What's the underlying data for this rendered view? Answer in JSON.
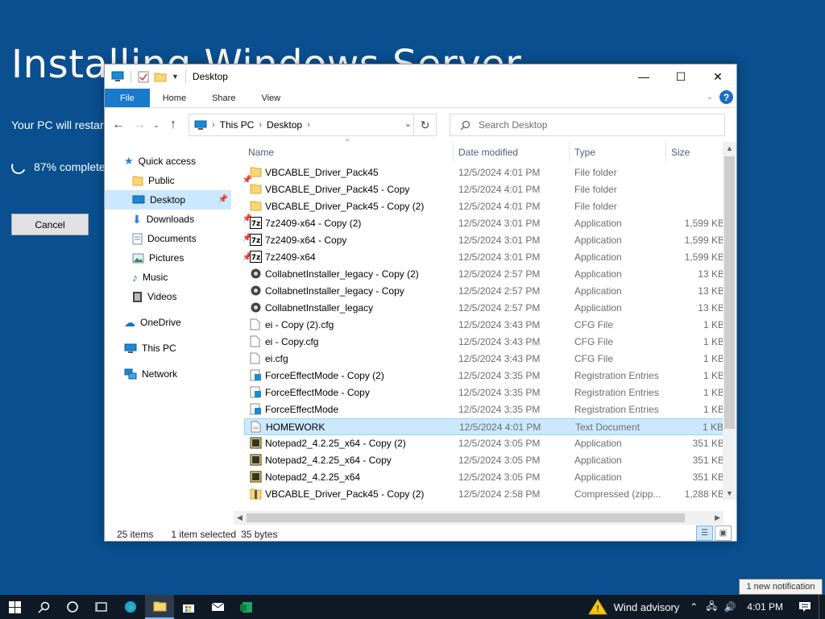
{
  "installer": {
    "title": "Installing Windows Server",
    "subtitle": "Your PC will restart several times. This might take a while.",
    "progress": "87% complete",
    "cancel_label": "Cancel"
  },
  "window": {
    "title": "Desktop",
    "ribbon_tabs": [
      "File",
      "Home",
      "Share",
      "View"
    ],
    "help_label": "?"
  },
  "address": {
    "crumbs": [
      "This PC",
      "Desktop"
    ],
    "search_placeholder": "Search Desktop"
  },
  "nav": {
    "quick_access": "Quick access",
    "items": [
      "Public",
      "Desktop",
      "Downloads",
      "Documents",
      "Pictures",
      "Music",
      "Videos"
    ],
    "onedrive": "OneDrive",
    "this_pc": "This PC",
    "network": "Network"
  },
  "columns": {
    "name": "Name",
    "date": "Date modified",
    "type": "Type",
    "size": "Size"
  },
  "files": [
    {
      "name": "VBCABLE_Driver_Pack45",
      "date": "12/5/2024 4:01 PM",
      "type": "File folder",
      "size": "",
      "icon": "folder"
    },
    {
      "name": "VBCABLE_Driver_Pack45 - Copy",
      "date": "12/5/2024 4:01 PM",
      "type": "File folder",
      "size": "",
      "icon": "folder"
    },
    {
      "name": "VBCABLE_Driver_Pack45 - Copy (2)",
      "date": "12/5/2024 4:01 PM",
      "type": "File folder",
      "size": "",
      "icon": "folder"
    },
    {
      "name": "7z2409-x64 - Copy (2)",
      "date": "12/5/2024 3:01 PM",
      "type": "Application",
      "size": "1,599 KB",
      "icon": "7z"
    },
    {
      "name": "7z2409-x64 - Copy",
      "date": "12/5/2024 3:01 PM",
      "type": "Application",
      "size": "1,599 KB",
      "icon": "7z"
    },
    {
      "name": "7z2409-x64",
      "date": "12/5/2024 3:01 PM",
      "type": "Application",
      "size": "1,599 KB",
      "icon": "7z"
    },
    {
      "name": "CollabnetInstaller_legacy - Copy (2)",
      "date": "12/5/2024 2:57 PM",
      "type": "Application",
      "size": "13 KB",
      "icon": "app"
    },
    {
      "name": "CollabnetInstaller_legacy - Copy",
      "date": "12/5/2024 2:57 PM",
      "type": "Application",
      "size": "13 KB",
      "icon": "app"
    },
    {
      "name": "CollabnetInstaller_legacy",
      "date": "12/5/2024 2:57 PM",
      "type": "Application",
      "size": "13 KB",
      "icon": "app"
    },
    {
      "name": "ei - Copy (2).cfg",
      "date": "12/5/2024 3:43 PM",
      "type": "CFG File",
      "size": "1 KB",
      "icon": "file"
    },
    {
      "name": "ei - Copy.cfg",
      "date": "12/5/2024 3:43 PM",
      "type": "CFG File",
      "size": "1 KB",
      "icon": "file"
    },
    {
      "name": "ei.cfg",
      "date": "12/5/2024 3:43 PM",
      "type": "CFG File",
      "size": "1 KB",
      "icon": "file"
    },
    {
      "name": "ForceEffectMode - Copy (2)",
      "date": "12/5/2024 3:35 PM",
      "type": "Registration Entries",
      "size": "1 KB",
      "icon": "reg"
    },
    {
      "name": "ForceEffectMode - Copy",
      "date": "12/5/2024 3:35 PM",
      "type": "Registration Entries",
      "size": "1 KB",
      "icon": "reg"
    },
    {
      "name": "ForceEffectMode",
      "date": "12/5/2024 3:35 PM",
      "type": "Registration Entries",
      "size": "1 KB",
      "icon": "reg"
    },
    {
      "name": "HOMEWORK",
      "date": "12/5/2024 4:01 PM",
      "type": "Text Document",
      "size": "1 KB",
      "icon": "txt",
      "selected": true
    },
    {
      "name": "Notepad2_4.2.25_x64 - Copy (2)",
      "date": "12/5/2024 3:05 PM",
      "type": "Application",
      "size": "351 KB",
      "icon": "np"
    },
    {
      "name": "Notepad2_4.2.25_x64 - Copy",
      "date": "12/5/2024 3:05 PM",
      "type": "Application",
      "size": "351 KB",
      "icon": "np"
    },
    {
      "name": "Notepad2_4.2.25_x64",
      "date": "12/5/2024 3:05 PM",
      "type": "Application",
      "size": "351 KB",
      "icon": "np"
    },
    {
      "name": "VBCABLE_Driver_Pack45 - Copy (2)",
      "date": "12/5/2024 2:58 PM",
      "type": "Compressed (zipp...",
      "size": "1,288 KB",
      "icon": "zip"
    }
  ],
  "status": {
    "count": "25 items",
    "selected": "1 item selected",
    "size": "35 bytes"
  },
  "taskbar": {
    "weather": "Wind advisory",
    "time": "4:01 PM",
    "notification_tooltip": "1 new notification"
  },
  "colors": {
    "background": "#0a4f8f",
    "accent": "#1979ca",
    "selection": "#cce8ff"
  }
}
